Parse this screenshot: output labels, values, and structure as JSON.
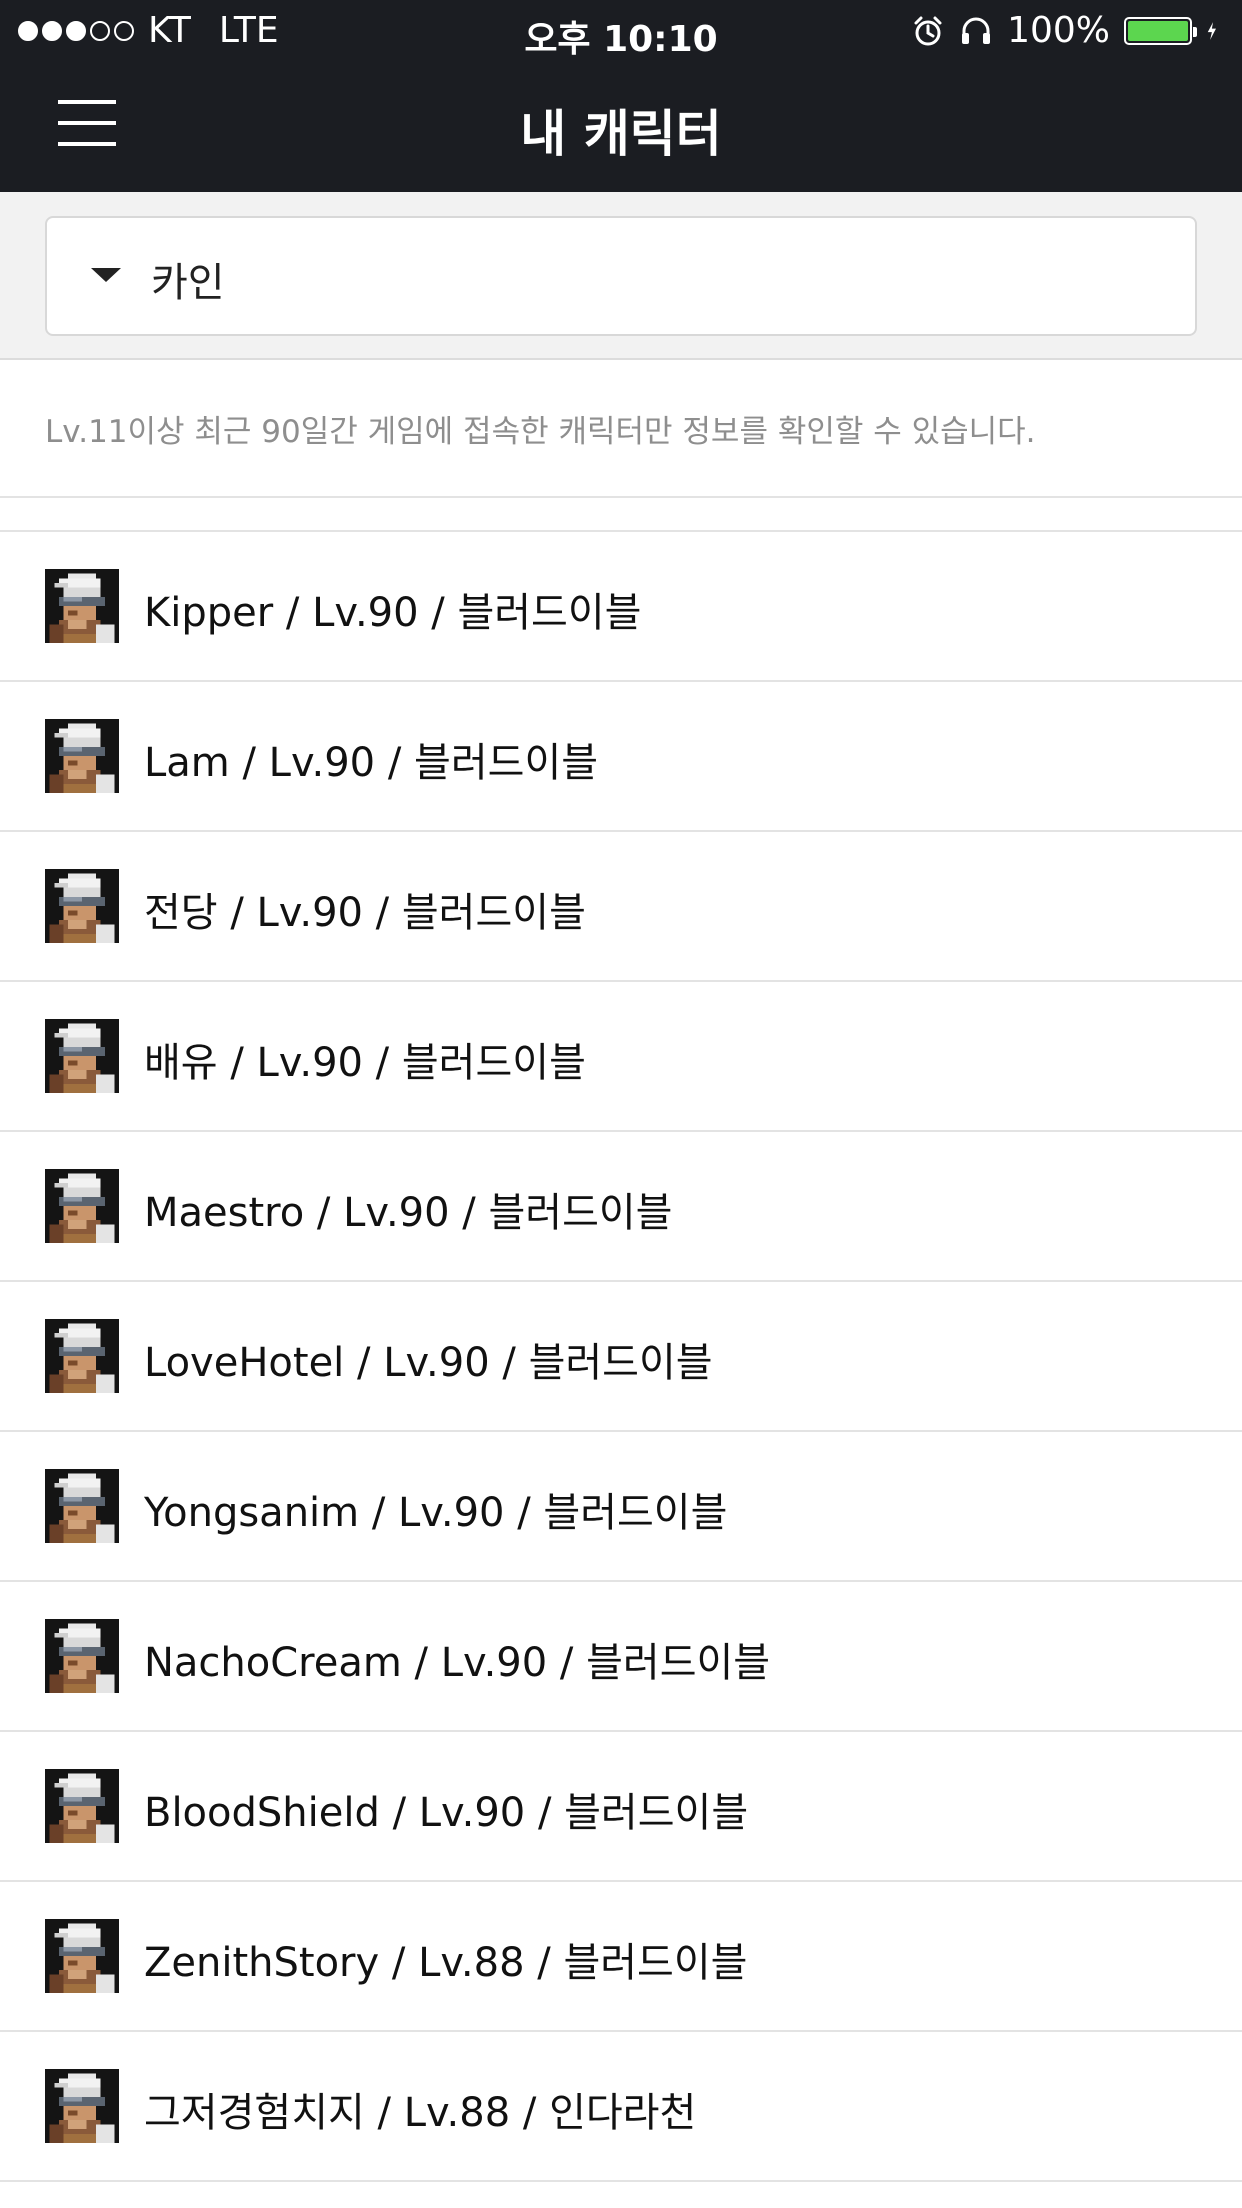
{
  "status_bar": {
    "carrier": "KT",
    "network": "LTE",
    "time": "오후 10:10",
    "battery": "100%",
    "signal_bars_filled": 3,
    "signal_bars_total": 5,
    "battery_level": 1.0,
    "battery_color": "#5cd64f",
    "icons": [
      "alarm-icon",
      "headphones-icon",
      "charging-bolt-icon"
    ]
  },
  "nav": {
    "title": "내 캐릭터",
    "menu_icon": "hamburger-menu-icon"
  },
  "server_select": {
    "selected": "카인",
    "caret_icon": "caret-down-icon"
  },
  "notice": "Lv.11이상 최근 90일간 게임에 접속한 캐릭터만 정보를 확인할 수 있습니다.",
  "characters": [
    "Kipper / Lv.90 / 블러드이블",
    "Lam / Lv.90 / 블러드이블",
    "전당 / Lv.90 / 블러드이블",
    "배유 / Lv.90 / 블러드이블",
    "Maestro / Lv.90 / 블러드이블",
    "LoveHotel / Lv.90 / 블러드이블",
    "Yongsanim / Lv.90 / 블러드이블",
    "NachoCream / Lv.90 / 블러드이블",
    "BloodShield / Lv.90 / 블러드이블",
    "ZenithStory / Lv.88 / 블러드이블",
    "그저경험치지 / Lv.88 / 인다라천"
  ]
}
